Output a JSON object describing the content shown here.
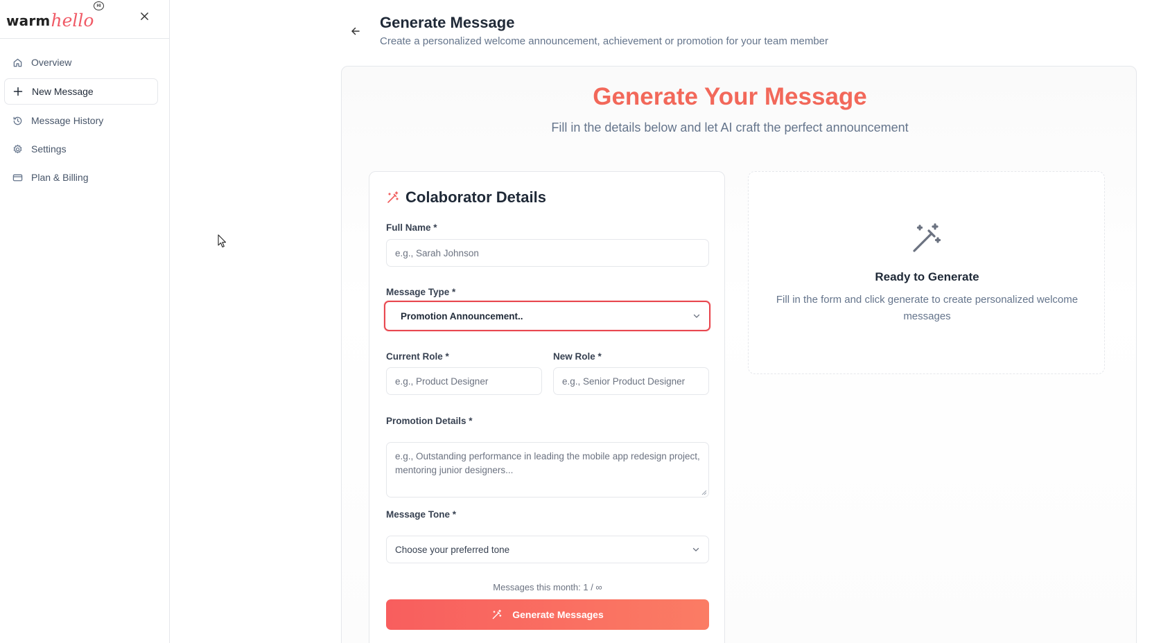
{
  "brand": {
    "name_part1": "warm",
    "name_part2": "hello",
    "badge": "HI"
  },
  "sidebar": {
    "items": [
      {
        "label": "Overview",
        "icon": "home-icon"
      },
      {
        "label": "New Message",
        "icon": "plus-icon",
        "active": true
      },
      {
        "label": "Message History",
        "icon": "history-icon"
      },
      {
        "label": "Settings",
        "icon": "gear-icon"
      },
      {
        "label": "Plan & Billing",
        "icon": "credit-card-icon"
      }
    ]
  },
  "header": {
    "title": "Generate Message",
    "subtitle": "Create a personalized welcome announcement, achievement or promotion for your team member"
  },
  "hero": {
    "title": "Generate Your Message",
    "subtitle": "Fill in the details below and let AI craft the perfect announcement"
  },
  "form": {
    "title": "Colaborator Details",
    "full_name": {
      "label": "Full Name *",
      "placeholder": "e.g., Sarah Johnson"
    },
    "message_type": {
      "label": "Message Type *",
      "value": "Promotion Announcement.."
    },
    "current_role": {
      "label": "Current Role *",
      "placeholder": "e.g., Product Designer"
    },
    "new_role": {
      "label": "New Role *",
      "placeholder": "e.g., Senior Product Designer"
    },
    "promotion_details": {
      "label": "Promotion Details *",
      "placeholder": "e.g., Outstanding performance in leading the mobile app redesign project, mentoring junior designers..."
    },
    "message_tone": {
      "label": "Message Tone *",
      "value": "Choose your preferred tone"
    },
    "counter": "Messages this month: 1 / ∞",
    "submit_label": "Generate Messages"
  },
  "preview": {
    "title": "Ready to Generate",
    "text": "Fill in the form and click generate to create personalized welcome messages"
  },
  "colors": {
    "accent": "#f2685a",
    "focus_border": "#e84850",
    "button_start": "#f85e5e",
    "button_end": "#fb7c64"
  }
}
